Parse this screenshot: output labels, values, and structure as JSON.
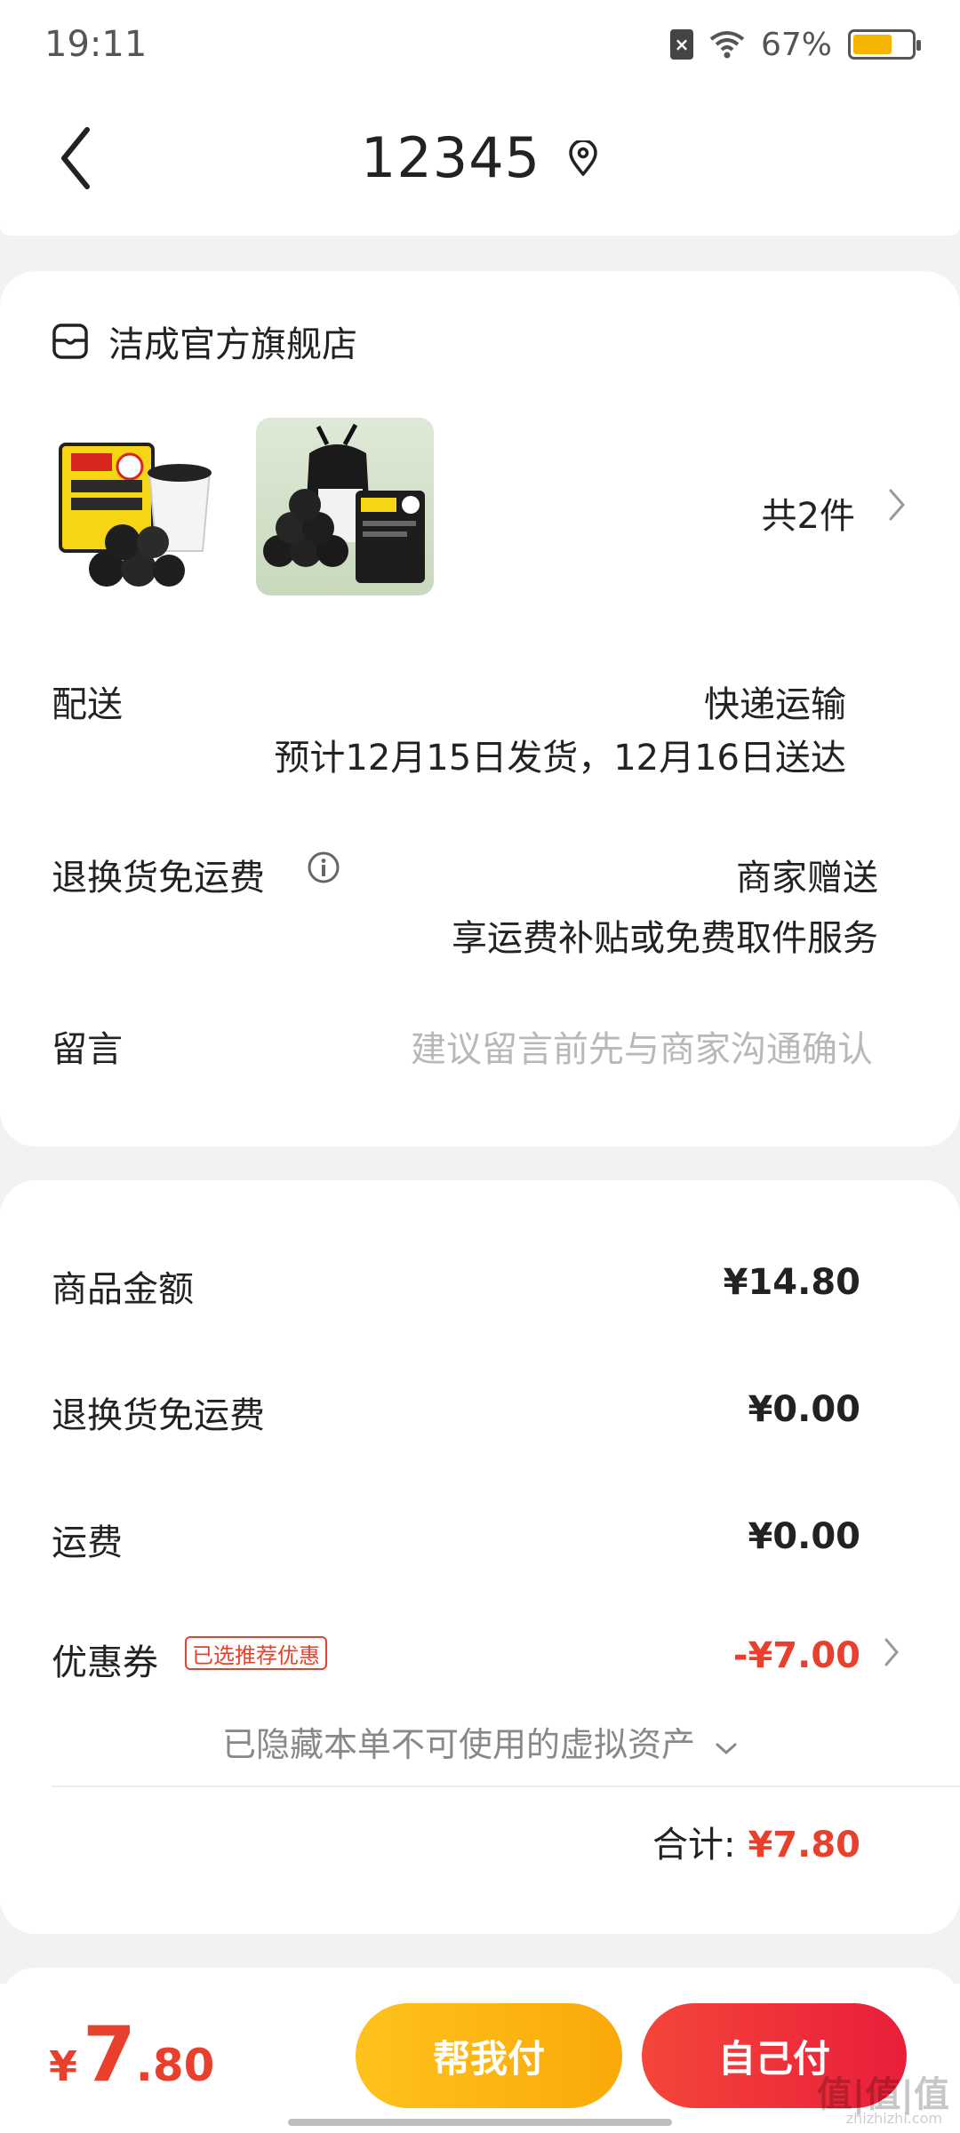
{
  "status_bar": {
    "time": "19:11",
    "battery_text": "67%",
    "battery_level": 0.67
  },
  "nav": {
    "title": "12345"
  },
  "order": {
    "store_name": "洁成官方旗舰店",
    "item_count": "共2件",
    "delivery": {
      "label": "配送",
      "method": "快递运输",
      "estimate": "预计12月15日发货，12月16日送达"
    },
    "return_shipping": {
      "label": "退换货免运费",
      "provider": "商家赠送",
      "desc": "享运费补贴或免费取件服务"
    },
    "memo": {
      "label": "留言",
      "placeholder": "建议留言前先与商家沟通确认"
    }
  },
  "pricing": {
    "goods_label": "商品金额",
    "goods_value": "¥14.80",
    "return_label": "退换货免运费",
    "return_value": "¥0.00",
    "shipping_label": "运费",
    "shipping_value": "¥0.00",
    "coupon_label": "优惠券",
    "coupon_tag": "已选推荐优惠",
    "coupon_value": "-¥7.00",
    "hidden_assets": "已隐藏本单不可使用的虚拟资产",
    "total_label": "合计:",
    "total_value": "¥7.80"
  },
  "bottom": {
    "currency": "¥",
    "price_int": "7",
    "price_dec": ".80",
    "help_pay": "帮我付",
    "self_pay": "自己付"
  },
  "watermark": {
    "main": "值|值|值",
    "sub": "zhizhizhi.com"
  },
  "colors": {
    "accent_red": "#e8402c",
    "help_btn": "#fbb614",
    "self_btn": "#ee3039"
  }
}
